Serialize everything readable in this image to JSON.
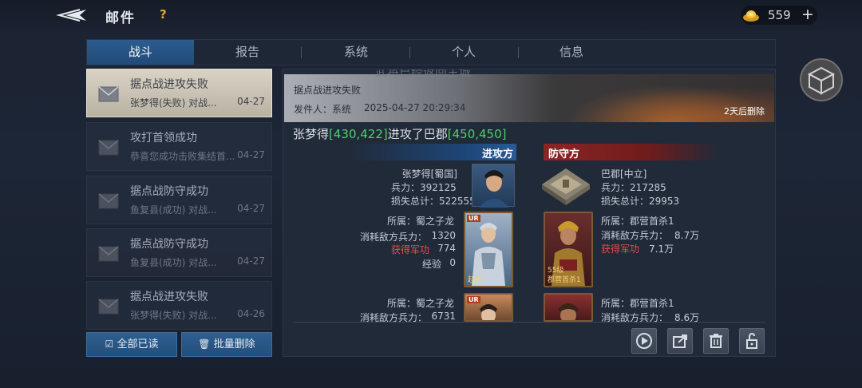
{
  "header": {
    "title": "邮件",
    "help_label": "?",
    "currency_value": "559",
    "plus_label": "+"
  },
  "tabs": [
    {
      "label": "战斗",
      "active": true
    },
    {
      "label": "报告"
    },
    {
      "label": "系统"
    },
    {
      "label": "个人"
    },
    {
      "label": "信息"
    }
  ],
  "mails": [
    {
      "title": "据点战进攻失败",
      "subtitle": "张梦得(失败) 对战...",
      "date": "04-27",
      "selected": true
    },
    {
      "title": "攻打首领成功",
      "subtitle": "恭喜您成功击败集结首...",
      "date": "04-27"
    },
    {
      "title": "据点战防守成功",
      "subtitle": "鱼复县(成功) 对战...",
      "date": "04-27"
    },
    {
      "title": "据点战防守成功",
      "subtitle": "鱼复县(成功) 对战...",
      "date": "04-27"
    },
    {
      "title": "据点战进攻失败",
      "subtitle": "张梦得(失败) 对战...",
      "date": "04-26"
    }
  ],
  "actions": {
    "read_all": "全部已读",
    "batch_delete": "批量删除"
  },
  "detail": {
    "toast": "武将已经返回主城",
    "title": "据点战进攻失败",
    "sender": "发件人：系统",
    "time": "2025-04-27 20:29:34",
    "expire": "2天后删除",
    "headline": {
      "attacker": "张梦得",
      "attacker_coord": "[430,422]",
      "verb": "进攻了巴郡",
      "target_coord": "[450,450]"
    },
    "attacker_label": "进攻方",
    "defender_label": "防守方",
    "attacker": {
      "name": "张梦得[蜀国]",
      "troops": "兵力：392125",
      "loss": "损失总计：522555"
    },
    "defender": {
      "name": "巴郡[中立]",
      "troops": "兵力：217285",
      "loss": "损失总计：29953"
    },
    "atk_rows": [
      {
        "belong": "所属：蜀之子龙",
        "consume_label": "消耗敌方兵力：",
        "consume_value": "1320",
        "merit_label": "获得军功",
        "merit_value": "774",
        "exp_label": "经验",
        "exp_value": "0",
        "card_name": "赵云",
        "card_badge": "UR"
      },
      {
        "belong": "所属：蜀之子龙",
        "consume_label": "消耗敌方兵力：",
        "consume_value": "6731",
        "card_badge": "UR"
      }
    ],
    "def_rows": [
      {
        "belong": "所属：郡营首杀1",
        "consume_label": "消耗敌方兵力：",
        "consume_value": "8.7万",
        "merit_label": "获得军功",
        "merit_value": "7.1万",
        "card_name": "郡营首杀1",
        "card_level": "55级"
      },
      {
        "belong": "所属：郡营首杀1",
        "consume_label": "消耗敌方兵力：",
        "consume_value": "8.6万"
      }
    ]
  },
  "icons": [
    "back-arrow-icon",
    "ingot-icon",
    "mail-icon",
    "checkbox-icon",
    "trash-icon",
    "play-icon",
    "share-icon",
    "delete-icon",
    "unlock-icon",
    "cube-icon"
  ],
  "colors": {
    "accent": "#2c5c8f",
    "attack": "#1d4679",
    "defense": "#8c2424",
    "highlight": "#4fd06a",
    "merit": "#e05050"
  }
}
